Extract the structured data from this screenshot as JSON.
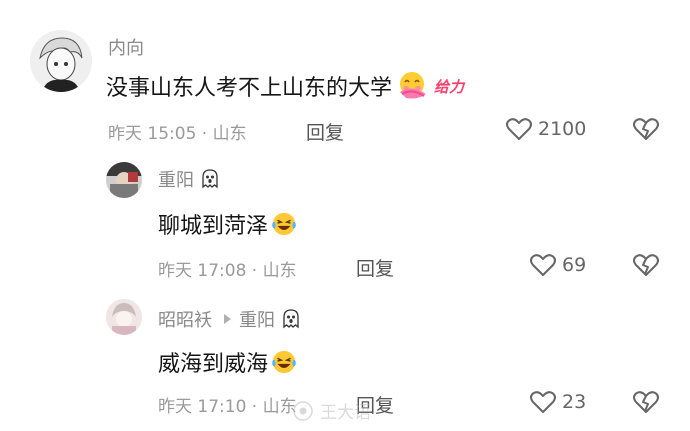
{
  "comments": [
    {
      "user": "内向",
      "text": "没事山东人考不上山东的大学",
      "sticker_text": "给力",
      "time_loc": "昨天 15:05 · 山东",
      "reply_label": "回复",
      "likes": "2100"
    },
    {
      "user": "重阳",
      "text": "聊城到菏泽",
      "time_loc": "昨天 17:08 · 山东",
      "reply_label": "回复",
      "likes": "69"
    },
    {
      "user": "昭昭袄",
      "reply_to": "重阳",
      "text": "威海到威海",
      "time_loc": "昨天 17:10 · 山东",
      "reply_label": "回复",
      "likes": "23"
    }
  ],
  "watermark": "王大语",
  "colors": {
    "text": "#161616",
    "muted": "#9a9a9a",
    "sticker": "#ff3e6c"
  }
}
